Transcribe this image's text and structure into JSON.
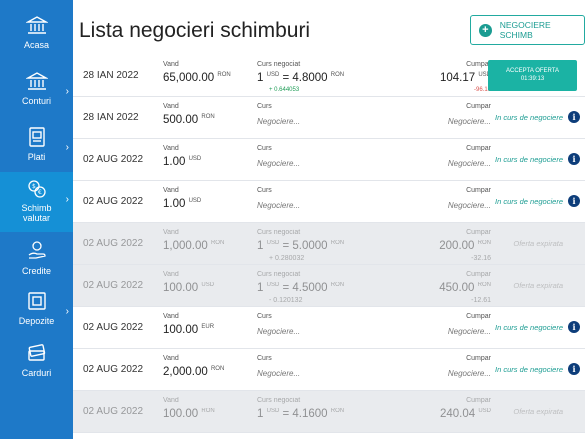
{
  "sidebar": {
    "items": [
      {
        "label": "Acasa",
        "icon": "bank-icon",
        "has_arrow": false,
        "active": false
      },
      {
        "label": "Conturi",
        "icon": "bank-icon",
        "has_arrow": true,
        "active": false
      },
      {
        "label": "Plati",
        "icon": "payment-document-icon",
        "has_arrow": true,
        "active": false
      },
      {
        "label_line1": "Schimb",
        "label_line2": "valutar",
        "icon": "currency-exchange-icon",
        "has_arrow": true,
        "active": true
      },
      {
        "label": "Credite",
        "icon": "credit-hand-icon",
        "has_arrow": false,
        "active": false
      },
      {
        "label": "Depozite",
        "icon": "deposit-icon",
        "has_arrow": true,
        "active": false
      },
      {
        "label": "Carduri",
        "icon": "card-icon",
        "has_arrow": false,
        "active": false
      }
    ]
  },
  "page": {
    "title": "Lista negocieri schimburi",
    "new_button_label": "NEGOCIERE SCHIMB"
  },
  "colors": {
    "sidebar": "#1e79c8",
    "sidebar_active": "#1590d6",
    "accent": "#1bb3a4",
    "positive": "#1f9d57",
    "negative": "#d9534f"
  },
  "rows": [
    {
      "date": "28 IAN 2022",
      "vand_label": "Vand",
      "vand_amount": "65,000.00",
      "vand_ccy": "RON",
      "curs_label": "Curs negociat",
      "curs_one": "1",
      "curs_from_ccy": "USD",
      "curs_eq": "= 4.8000",
      "curs_to_ccy": "RON",
      "curs_delta": "+ 0.644053",
      "cump_label": "Cumpar",
      "cump_amount": "104.17",
      "cump_ccy": "USD",
      "cump_delta": "-96.16",
      "action_line1": "ACCEPTA OFERTA",
      "action_line2": "01:39:13",
      "state": "offer"
    },
    {
      "date": "28 IAN 2022",
      "vand_label": "Vand",
      "vand_amount": "500.00",
      "vand_ccy": "RON",
      "curs_label": "Curs",
      "curs_neg": "Negociere...",
      "cump_label": "Cumpar",
      "cump_neg": "Negociere...",
      "status": "In curs de negociere",
      "state": "pending"
    },
    {
      "date": "02 AUG 2022",
      "vand_label": "Vand",
      "vand_amount": "1.00",
      "vand_ccy": "USD",
      "curs_label": "Curs",
      "curs_neg": "Negociere...",
      "cump_label": "Cumpar",
      "cump_neg": "Negociere...",
      "status": "In curs de negociere",
      "state": "pending"
    },
    {
      "date": "02 AUG 2022",
      "vand_label": "Vand",
      "vand_amount": "1.00",
      "vand_ccy": "USD",
      "curs_label": "Curs",
      "curs_neg": "Negociere...",
      "cump_label": "Cumpar",
      "cump_neg": "Negociere...",
      "status": "In curs de negociere",
      "state": "pending"
    },
    {
      "date": "02 AUG 2022",
      "vand_label": "Vand",
      "vand_amount": "1,000.00",
      "vand_ccy": "RON",
      "curs_label": "Curs negociat",
      "curs_one": "1",
      "curs_from_ccy": "USD",
      "curs_eq": "= 5.0000",
      "curs_to_ccy": "RON",
      "curs_delta": "+ 0.280032",
      "cump_label": "Cumpar",
      "cump_amount": "200.00",
      "cump_ccy": "RON",
      "cump_delta": "-32.16",
      "status": "Oferta expirata",
      "state": "expired"
    },
    {
      "date": "02 AUG 2022",
      "vand_label": "Vand",
      "vand_amount": "100.00",
      "vand_ccy": "USD",
      "curs_label": "Curs negociat",
      "curs_one": "1",
      "curs_from_ccy": "USD",
      "curs_eq": "= 4.5000",
      "curs_to_ccy": "RON",
      "curs_delta": "- 0.120132",
      "cump_label": "Cumpar",
      "cump_amount": "450.00",
      "cump_ccy": "RON",
      "cump_delta": "-12.61",
      "status": "Oferta expirata",
      "state": "expired"
    },
    {
      "date": "02 AUG 2022",
      "vand_label": "Vand",
      "vand_amount": "100.00",
      "vand_ccy": "EUR",
      "curs_label": "Curs",
      "curs_neg": "Negociere...",
      "cump_label": "Cumpar",
      "cump_neg": "Negociere...",
      "status": "In curs de negociere",
      "state": "pending"
    },
    {
      "date": "02 AUG 2022",
      "vand_label": "Vand",
      "vand_amount": "2,000.00",
      "vand_ccy": "RON",
      "curs_label": "Curs",
      "curs_neg": "Negociere...",
      "cump_label": "Cumpar",
      "cump_neg": "Negociere...",
      "status": "In curs de negociere",
      "state": "pending"
    },
    {
      "date": "02 AUG 2022",
      "vand_label": "Vand",
      "vand_amount": "100.00",
      "vand_ccy": "RON",
      "curs_label": "Curs negociat",
      "curs_one": "1",
      "curs_from_ccy": "USD",
      "curs_eq": "= 4.1600",
      "curs_to_ccy": "RON",
      "curs_delta": "",
      "cump_label": "Cumpar",
      "cump_amount": "240.04",
      "cump_ccy": "USD",
      "cump_delta": "",
      "status": "Oferta expirata",
      "state": "expired"
    }
  ]
}
